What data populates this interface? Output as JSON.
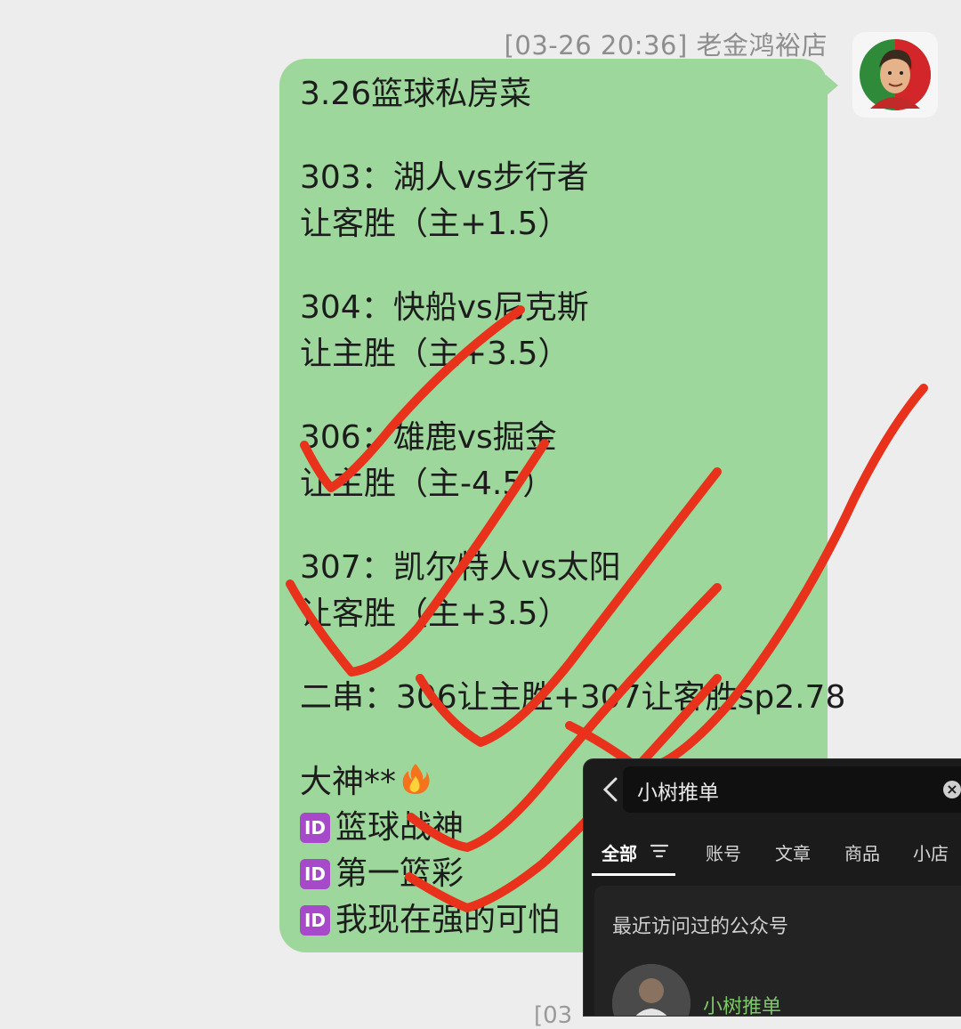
{
  "message": {
    "header": "[03-26 20:36] 老金鸿裕店",
    "lines": [
      "3.26篮球私房菜",
      "303：湖人vs步行者",
      "让客胜（主+1.5）",
      "304：快船vs尼克斯",
      "让主胜（主+3.5）",
      "306：雄鹿vs掘金",
      "让主胜（主-4.5）",
      "307：凯尔特人vs太阳",
      "让客胜（主+3.5）",
      "二串：306让主胜+307让客胜sp2.78",
      "大神**"
    ],
    "id_lines": [
      "篮球战神",
      "第一篮彩",
      "我现在强的可怕"
    ],
    "id_badge": "ID"
  },
  "search_panel": {
    "query": "小树推单",
    "clear_glyph": "×",
    "tabs": [
      "全部",
      "账号",
      "文章",
      "商品",
      "小店"
    ],
    "active_tab": "全部",
    "section_title": "最近访问过的公众号",
    "account_name": "小树推单"
  },
  "next_timestamp_fragment": "[03",
  "colors": {
    "bubble": "#9ed79b",
    "annotation": "#e8321c",
    "id_badge": "#a64ac9",
    "panel_bg": "#1b1b1b",
    "account_name": "#7fc86a"
  }
}
